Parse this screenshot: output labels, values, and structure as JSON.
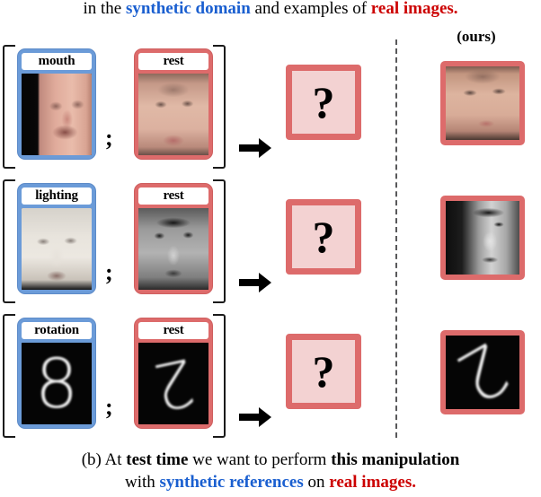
{
  "top_caption": {
    "segments": [
      {
        "text": "in the ",
        "style": "plain"
      },
      {
        "text": "synthetic domain",
        "style": "blue-bold"
      },
      {
        "text": " and examples of ",
        "style": "plain"
      },
      {
        "text": "real images.",
        "style": "red-bold"
      }
    ],
    "plain_text": "in the synthetic domain and examples of real images."
  },
  "ours_label": "(ours)",
  "arrow_symbol": "→",
  "question_symbol": "?",
  "separator_symbol": ";",
  "colors": {
    "blue_border": "#6b9bd8",
    "red_border": "#dd6b6b",
    "question_fill": "#f3d2d2",
    "blue_text": "#1a5fd0",
    "red_text": "#cc0000",
    "divider": "#58585a"
  },
  "rows": [
    {
      "attribute_label": "mouth",
      "rest_label": "rest",
      "attribute_image": "synthetic-face-crying-man",
      "rest_image": "real-face-woman-color",
      "output_image": "question-unknown",
      "result_image": "result-face-woman-color",
      "digit_attribute": null,
      "digit_rest": null
    },
    {
      "attribute_label": "lighting",
      "rest_label": "rest",
      "attribute_image": "synthetic-face-overlit",
      "rest_image": "real-face-grayscale-frontal",
      "output_image": "question-unknown",
      "result_image": "result-face-grayscale-sidelit",
      "digit_attribute": null,
      "digit_rest": null
    },
    {
      "attribute_label": "rotation",
      "rest_label": "rest",
      "attribute_image": "synthetic-digit-eight",
      "rest_image": "real-digit-two-rotated",
      "output_image": "question-unknown",
      "result_image": "result-digit-two-rotated",
      "digit_attribute": "8",
      "digit_rest": "2"
    }
  ],
  "bottom_caption": {
    "line1": [
      {
        "text": "(b) At ",
        "style": "plain"
      },
      {
        "text": "test time",
        "style": "blk-bold"
      },
      {
        "text": " we want to perform ",
        "style": "plain"
      },
      {
        "text": "this manipulation",
        "style": "blk-bold"
      }
    ],
    "line2": [
      {
        "text": "with ",
        "style": "plain"
      },
      {
        "text": "synthetic references",
        "style": "blue-bold"
      },
      {
        "text": " on ",
        "style": "plain"
      },
      {
        "text": "real images.",
        "style": "red-bold"
      }
    ],
    "plain_text": "(b) At test time we want to perform this manipulation with synthetic references on real images."
  }
}
